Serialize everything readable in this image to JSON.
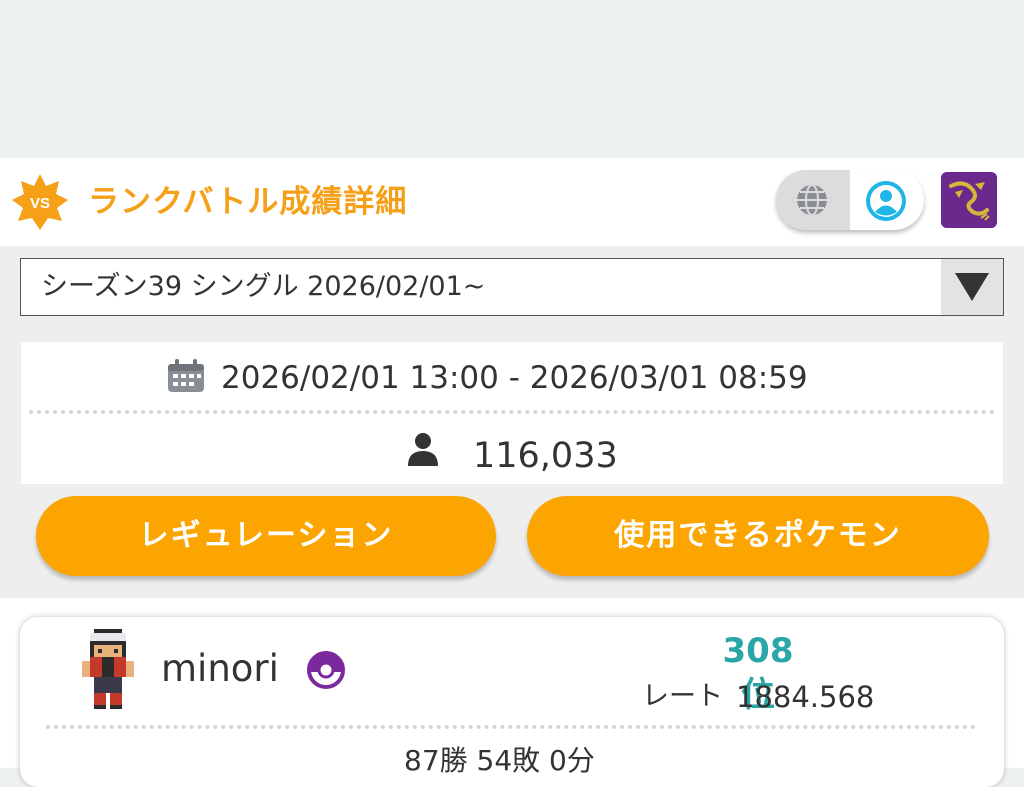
{
  "header": {
    "badge_text": "VS",
    "title": "ランクバトル成績詳細",
    "icons": [
      "globe-icon",
      "user-circle-icon",
      "dragon-avatar-icon"
    ]
  },
  "season_select": {
    "selected": "シーズン39 シングル 2026/02/01~"
  },
  "season_info": {
    "period": "2026/02/01 13:00 - 2026/03/01 08:59",
    "players": "116,033"
  },
  "buttons": {
    "regulation": "レギュレーション",
    "usable_pokemon": "使用できるポケモン"
  },
  "player": {
    "name": "minori",
    "rank": "308位",
    "rate_label": "レート",
    "rate_value": "1884.568",
    "record": "87勝 54敗 0分"
  },
  "colors": {
    "accent_orange": "#f5a018",
    "button_orange": "#fca400",
    "rank_teal": "#2aa6a6",
    "avatar_purple": "#6a2a8c"
  }
}
